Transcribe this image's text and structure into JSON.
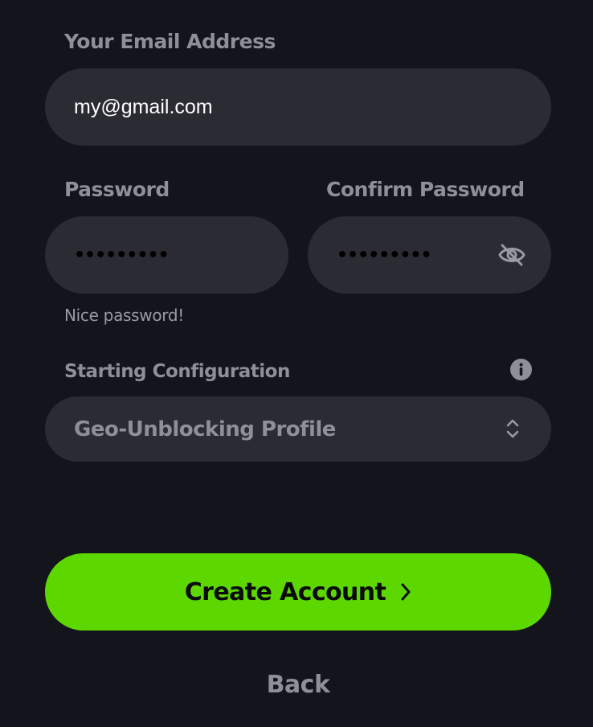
{
  "email": {
    "label": "Your Email Address",
    "value": "my@gmail.com"
  },
  "password": {
    "label": "Password",
    "value": "•••••••••",
    "helper": "Nice password!"
  },
  "confirm_password": {
    "label": "Confirm Password",
    "value": "•••••••••",
    "toggle_icon": "eye-off-icon"
  },
  "configuration": {
    "label": "Starting Configuration",
    "info_icon": "info-icon",
    "selected": "Geo-Unblocking Profile",
    "select_icon": "chevron-up-down-icon"
  },
  "actions": {
    "create_account": "Create Account",
    "create_icon": "chevron-right-icon",
    "back": "Back"
  },
  "colors": {
    "background": "#14141c",
    "field": "#2b2b33",
    "label": "#8f8f98",
    "accent": "#5cd800"
  }
}
